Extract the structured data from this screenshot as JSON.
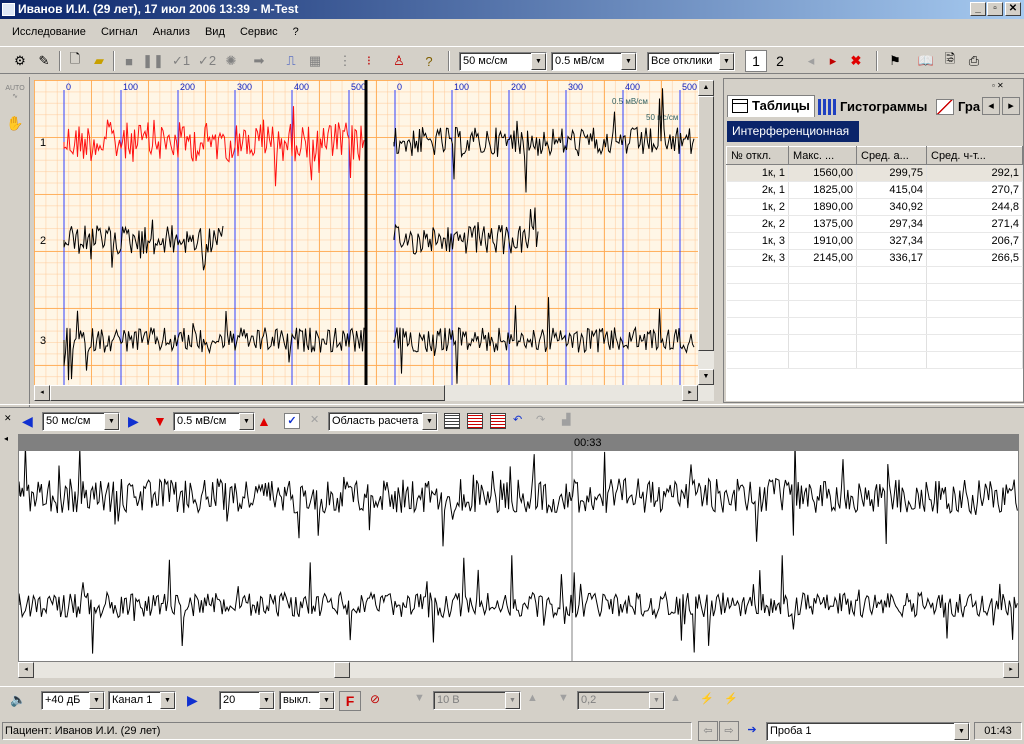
{
  "window": {
    "title": "Иванов И.И. (29 лет), 17 июл 2006 13:39 - M-Test"
  },
  "menu": [
    "Исследование",
    "Сигнал",
    "Анализ",
    "Вид",
    "Сервис",
    "?"
  ],
  "toolbar": {
    "time_scale": "50 мс/см",
    "amp_scale": "0.5 мВ/см",
    "responses": "Все отклики",
    "page1": "1",
    "page2": "2"
  },
  "side": {
    "auto_label": "AUTO"
  },
  "top_chart": {
    "x_ticks_left": [
      "0",
      "100",
      "200",
      "300",
      "400",
      "500"
    ],
    "x_ticks_right": [
      "0",
      "100",
      "200",
      "300",
      "400",
      "500"
    ],
    "channels": [
      "1",
      "2",
      "3"
    ],
    "scale_amp": "0.5 мВ/см",
    "scale_time": "50 мс/см"
  },
  "right_panel": {
    "tabs": [
      "Таблицы",
      "Гистограммы",
      "Гра"
    ],
    "subtab": "Интерференционная",
    "columns": [
      "№ откл.",
      "Макс. ...",
      "Сред. а...",
      "Сред. ч-т..."
    ],
    "rows": [
      [
        "1к, 1",
        "1560,00",
        "299,75",
        "292,1"
      ],
      [
        "2к, 1",
        "1825,00",
        "415,04",
        "270,7"
      ],
      [
        "1к, 2",
        "1890,00",
        "340,92",
        "244,8"
      ],
      [
        "2к, 2",
        "1375,00",
        "297,34",
        "271,4"
      ],
      [
        "1к, 3",
        "1910,00",
        "327,34",
        "206,7"
      ],
      [
        "2к, 3",
        "2145,00",
        "336,17",
        "266,5"
      ]
    ]
  },
  "lower_toolbar": {
    "time_scale": "50 мс/см",
    "amp_scale": "0.5 мВ/см",
    "area": "Область расчета"
  },
  "lower_chart": {
    "time_marker": "00:33"
  },
  "bottom_toolbar": {
    "gain": "+40 дБ",
    "channel": "Канал 1",
    "value": "20",
    "filter_mode": "выкл.",
    "f_label": "F",
    "voltage": "10 В",
    "small_value": "0,2"
  },
  "status": {
    "patient": "Пациент: Иванов И.И. (29 лет)",
    "probe": "Проба 1",
    "time": "01:43"
  },
  "colors": {
    "title_start": "#0a246a",
    "red_signal": "#ff1010",
    "grid_orange": "#ffaa50",
    "subtab_bg": "#0a246a"
  }
}
